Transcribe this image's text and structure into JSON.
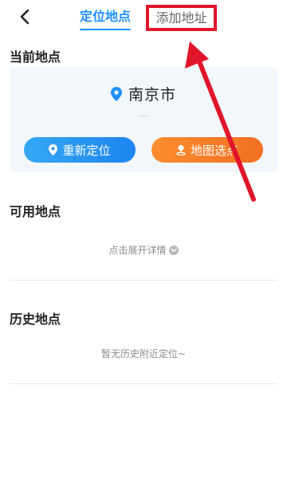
{
  "header": {
    "back_icon": "chevron-left-icon",
    "tabs": [
      {
        "label": "定位地点",
        "active": true
      },
      {
        "label": "添加地址",
        "active": false
      }
    ]
  },
  "current_location": {
    "title": "当前地点",
    "city": "南京市",
    "subtitle": "---",
    "relocate_label": "重新定位",
    "map_pick_label": "地图选点"
  },
  "available_locations": {
    "title": "可用地点",
    "expand_label": "点击展开详情"
  },
  "history_locations": {
    "title": "历史地点",
    "empty_text": "暂无历史附近定位~"
  },
  "colors": {
    "accent": "#1e90ff",
    "relocate_button": "#2a95f3",
    "map_button": "#f67d28",
    "annotation": "#e0152a"
  }
}
